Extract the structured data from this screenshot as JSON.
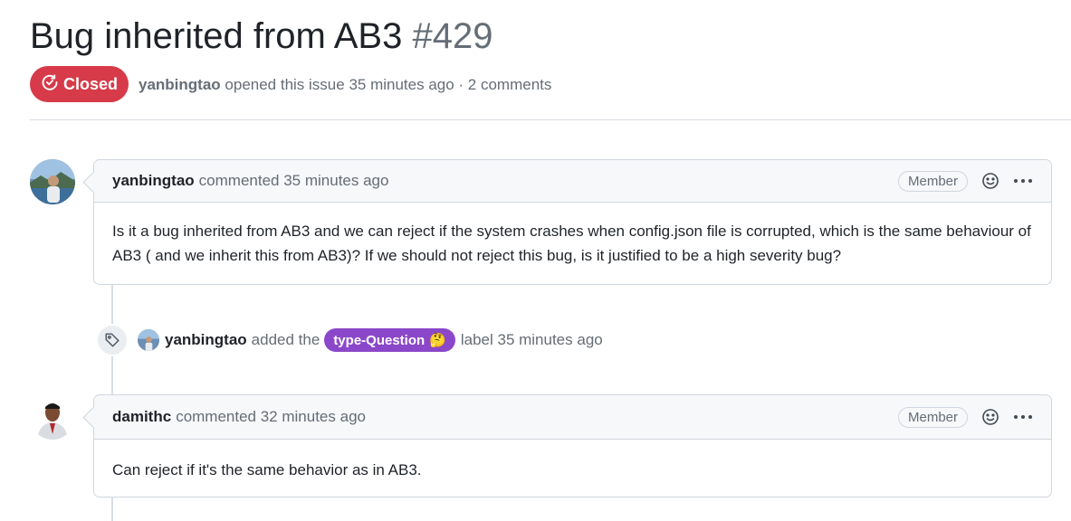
{
  "issue": {
    "title": "Bug inherited from AB3",
    "number": "#429",
    "state": "Closed",
    "author": "yanbingtao",
    "meta_text": "opened this issue 35 minutes ago · 2 comments"
  },
  "comments": [
    {
      "author": "yanbingtao",
      "action": "commented 35 minutes ago",
      "badge": "Member",
      "body": "Is it a bug inherited from AB3 and we can reject if the system crashes when config.json file is corrupted, which is the same behaviour of AB3 ( and we inherit this from AB3)? If we should not reject this bug, is it justified to be a high severity bug?"
    },
    {
      "author": "damithc",
      "action": "commented 32 minutes ago",
      "badge": "Member",
      "body": "Can reject if it's the same behavior as in AB3."
    }
  ],
  "label_event": {
    "actor": "yanbingtao",
    "text_before": "added the",
    "label": "type-Question",
    "label_emoji": "🤔",
    "text_after": "label 35 minutes ago",
    "label_color": "#8b47c9"
  },
  "colors": {
    "closed": "#d73a49",
    "border": "#d0d7de",
    "muted": "#656d76"
  },
  "icons": {
    "state": "issue-closed-icon",
    "reaction": "smiley-icon",
    "menu": "kebab-horizontal-icon",
    "event": "tag-icon"
  }
}
